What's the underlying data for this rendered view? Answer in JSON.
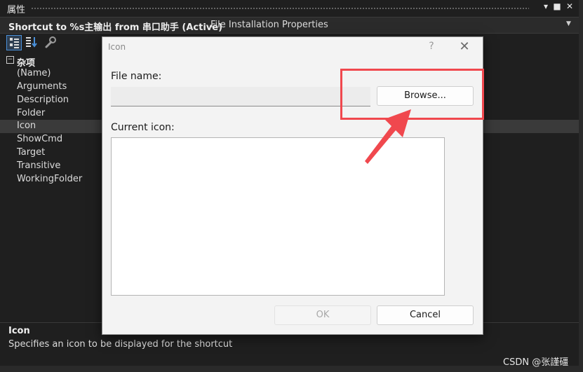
{
  "window": {
    "title": "属性",
    "pin_glyph": "▾",
    "maximize_glyph": "■",
    "close_glyph": "✕"
  },
  "object_selector": {
    "name": "Shortcut to %s主输出 from 串口助手 (Active)",
    "type": "File Installation Properties",
    "dropdown_glyph": "▼"
  },
  "toolbar": {
    "items": [
      "categorized-icon",
      "alphabetical-icon",
      "property-pages-icon"
    ]
  },
  "grid": {
    "category": {
      "toggle": "−",
      "label": "杂项"
    },
    "properties": [
      {
        "name": "(Name)"
      },
      {
        "name": "Arguments"
      },
      {
        "name": "Description"
      },
      {
        "name": "Folder"
      },
      {
        "name": "Icon"
      },
      {
        "name": "ShowCmd"
      },
      {
        "name": "Target"
      },
      {
        "name": "Transitive"
      },
      {
        "name": "WorkingFolder"
      }
    ]
  },
  "description": {
    "title": "Icon",
    "text": "Specifies an icon to be displayed for the shortcut"
  },
  "watermark": "CSDN @张謹礓",
  "dialog": {
    "title": "Icon",
    "help": "?",
    "close": "✕",
    "file_name_label": "File name:",
    "file_name_value": "",
    "browse_label": "Browse...",
    "current_icon_label": "Current icon:",
    "ok_label": "OK",
    "cancel_label": "Cancel"
  },
  "annotation": {
    "color": "#f0484e"
  }
}
